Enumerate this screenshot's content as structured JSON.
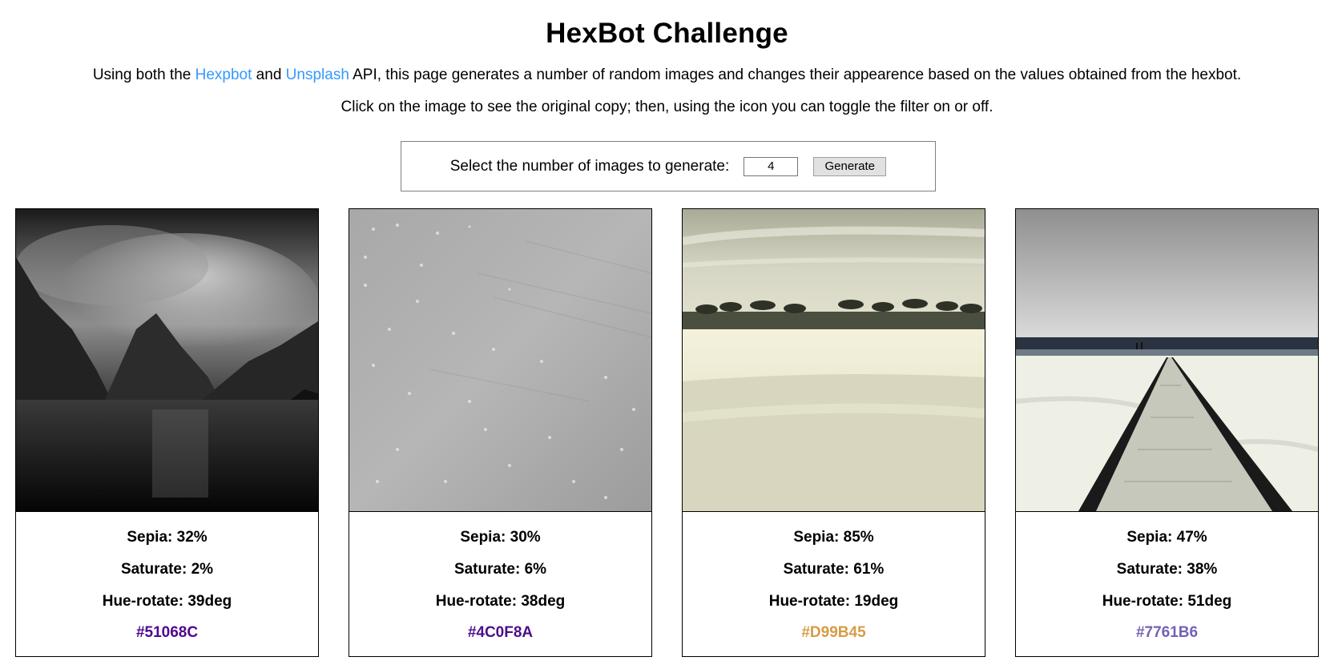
{
  "page": {
    "title": "HexBot Challenge",
    "intro_before": "Using both the ",
    "hexpbot_link": "Hexpbot",
    "intro_and": " and ",
    "unsplash_link": "Unsplash",
    "intro_after": " API, this page generates a number of random images and changes their appearence based on the values obtained from the hexbot.",
    "instructions": "Click on the image to see the original copy; then, using the icon you can toggle the filter on or off."
  },
  "controls": {
    "label": "Select the number of images to generate:",
    "count_value": "4",
    "generate_label": "Generate"
  },
  "cards": [
    {
      "sepia": "Sepia: 32%",
      "saturate": "Saturate: 2%",
      "hue": "Hue-rotate: 39deg",
      "hex": "#51068C",
      "hex_color": "#51068C",
      "image_subject": "foggy-mountain-lake"
    },
    {
      "sepia": "Sepia: 30%",
      "saturate": "Saturate: 6%",
      "hue": "Hue-rotate: 38deg",
      "hex": "#4C0F8A",
      "hex_color": "#4C0F8A",
      "image_subject": "metal-surface-texture"
    },
    {
      "sepia": "Sepia: 85%",
      "saturate": "Saturate: 61%",
      "hue": "Hue-rotate: 19deg",
      "hex": "#D99B45",
      "hex_color": "#D99B45",
      "image_subject": "tropical-beach-palms"
    },
    {
      "sepia": "Sepia: 47%",
      "saturate": "Saturate: 38%",
      "hue": "Hue-rotate: 51deg",
      "hex": "#7761B6",
      "hex_color": "#7761B6",
      "image_subject": "beach-boardwalk"
    }
  ],
  "colors": {
    "link": "#3399FF",
    "text": "#000000",
    "border": "#000000"
  }
}
